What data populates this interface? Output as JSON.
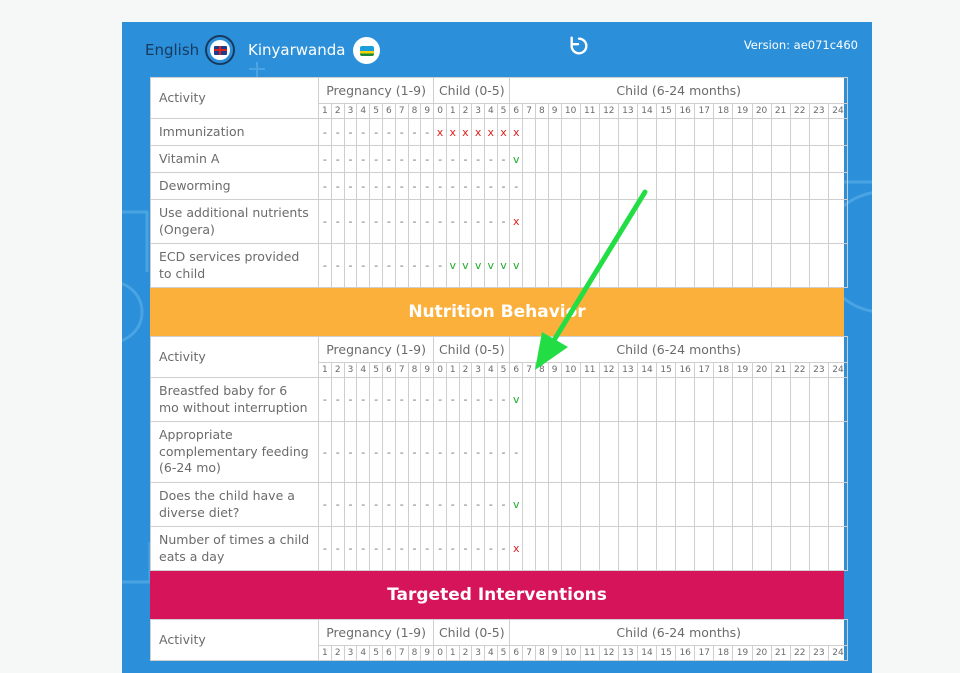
{
  "header": {
    "lang_en": "English",
    "lang_rw": "Kinyarwanda",
    "version": "Version: ae071c460",
    "reload_icon": "reload-icon"
  },
  "column_groups": {
    "pregnancy": "Pregnancy (1-9)",
    "child05": "Child (0-5)",
    "child624": "Child (6-24 months)"
  },
  "column_numbers": {
    "pregnancy": [
      "1",
      "2",
      "3",
      "4",
      "5",
      "6",
      "7",
      "8",
      "9"
    ],
    "child05": [
      "0",
      "1",
      "2",
      "3",
      "4",
      "5"
    ],
    "child624": [
      "6",
      "7",
      "8",
      "9",
      "10",
      "11",
      "12",
      "13",
      "14",
      "15",
      "16",
      "17",
      "18",
      "19",
      "20",
      "21",
      "22",
      "23",
      "24"
    ]
  },
  "sections": [
    {
      "title": "",
      "activity_label": "Activity",
      "rows": [
        {
          "label": "Immunization",
          "h": 27,
          "cells": [
            "-",
            "-",
            "-",
            "-",
            "-",
            "-",
            "-",
            "-",
            "-",
            "x",
            "x",
            "x",
            "x",
            "x",
            "x",
            "x"
          ]
        },
        {
          "label": "Vitamin A",
          "h": 27,
          "cells": [
            "-",
            "-",
            "-",
            "-",
            "-",
            "-",
            "-",
            "-",
            "-",
            "-",
            "-",
            "-",
            "-",
            "-",
            "-",
            "v"
          ]
        },
        {
          "label": "Deworming",
          "h": 27,
          "cells": [
            "-",
            "-",
            "-",
            "-",
            "-",
            "-",
            "-",
            "-",
            "-",
            "-",
            "-",
            "-",
            "-",
            "-",
            "-",
            "-"
          ]
        },
        {
          "label": "Use additional nutrients (Ongera)",
          "h": 44,
          "cells": [
            "-",
            "-",
            "-",
            "-",
            "-",
            "-",
            "-",
            "-",
            "-",
            "-",
            "-",
            "-",
            "-",
            "-",
            "-",
            "x"
          ]
        },
        {
          "label": "ECD services provided to child",
          "h": 44,
          "cells": [
            "-",
            "-",
            "-",
            "-",
            "-",
            "-",
            "-",
            "-",
            "-",
            "-",
            "v",
            "v",
            "v",
            "v",
            "v",
            "v"
          ]
        }
      ]
    },
    {
      "title": "Nutrition Behavior",
      "color": "#fbb03b",
      "activity_label": "Activity",
      "rows": [
        {
          "label": "Breastfed baby for 6 mo without interruption",
          "h": 44,
          "cells": [
            "-",
            "-",
            "-",
            "-",
            "-",
            "-",
            "-",
            "-",
            "-",
            "-",
            "-",
            "-",
            "-",
            "-",
            "-",
            "v"
          ]
        },
        {
          "label": "Appropriate complementary feeding (6-24 mo)",
          "h": 61,
          "cells": [
            "-",
            "-",
            "-",
            "-",
            "-",
            "-",
            "-",
            "-",
            "-",
            "-",
            "-",
            "-",
            "-",
            "-",
            "-",
            "-"
          ]
        },
        {
          "label": "Does the child have a diverse diet?",
          "h": 44,
          "cells": [
            "-",
            "-",
            "-",
            "-",
            "-",
            "-",
            "-",
            "-",
            "-",
            "-",
            "-",
            "-",
            "-",
            "-",
            "-",
            "v"
          ]
        },
        {
          "label": "Number of times a child eats a day",
          "h": 44,
          "cells": [
            "-",
            "-",
            "-",
            "-",
            "-",
            "-",
            "-",
            "-",
            "-",
            "-",
            "-",
            "-",
            "-",
            "-",
            "-",
            "x"
          ]
        }
      ]
    },
    {
      "title": "Targeted Interventions",
      "color": "#d6145a",
      "activity_label": "Activity",
      "rows": []
    }
  ]
}
